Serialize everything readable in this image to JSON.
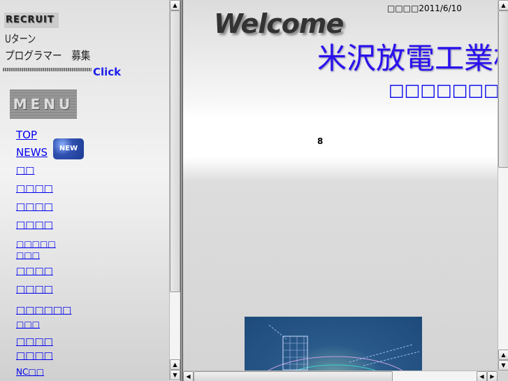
{
  "left_frame": {
    "recruit_label": "RECRUIT",
    "recruit_line1": "Uターン",
    "recruit_line2": "プログラマー　募集",
    "click_label": "Click",
    "menu_label": "MENU",
    "new_badge": "NEW",
    "items": [
      {
        "label": "TOP"
      },
      {
        "label": "NEWS"
      },
      {
        "label": "□□"
      },
      {
        "label": "□□□□"
      },
      {
        "label": "□□□□"
      },
      {
        "label": "□□□□"
      },
      {
        "label": "□□□□□",
        "label2": "□□□"
      },
      {
        "label": "□□□□"
      },
      {
        "label": "□□□□"
      },
      {
        "label": "□□□□□□",
        "label2": "□□□"
      },
      {
        "label": "□□□□",
        "label2": "□□□□"
      },
      {
        "label": "NC□□"
      }
    ]
  },
  "right_frame": {
    "welcome": "Welcome",
    "updated": "□□□□2011/6/10",
    "company": "米沢放電工業株",
    "subtitle": "□□□□□□□□□□□□",
    "counter": "8"
  }
}
